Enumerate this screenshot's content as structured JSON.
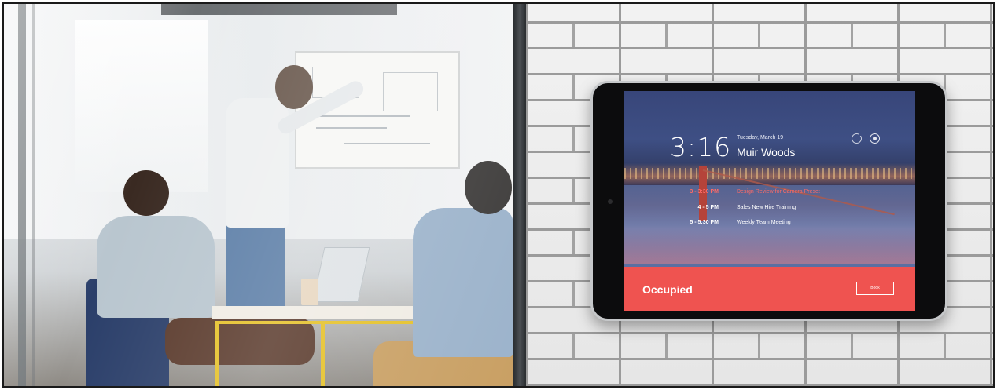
{
  "display": {
    "clock_time": "3:16",
    "date": "Tuesday, March 19",
    "room_name": "Muir Woods",
    "icons": {
      "refresh": "refresh-icon",
      "settings": "settings-icon"
    },
    "events": [
      {
        "time": "3 - 3:30 PM",
        "title": "Design Review for Camera Preset",
        "active": true
      },
      {
        "time": "4 - 5 PM",
        "title": "Sales New Hire Training",
        "active": false
      },
      {
        "time": "5 - 5:30 PM",
        "title": "Weekly Team Meeting",
        "active": false
      }
    ],
    "status": "Occupied",
    "book_label": "Book",
    "colors": {
      "status_bar": "#ef5350",
      "active_event": "#ff6b66"
    }
  }
}
